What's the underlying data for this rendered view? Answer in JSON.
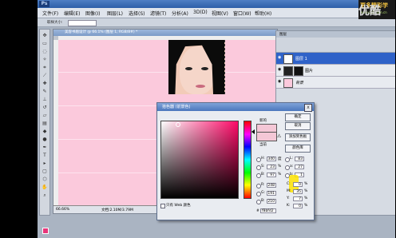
{
  "app": {
    "logo": "Ps",
    "menu": [
      "文件(F)",
      "编辑(E)",
      "图像(I)",
      "图层(L)",
      "选择(S)",
      "滤镜(T)",
      "分析(A)",
      "3D(D)",
      "视图(V)",
      "窗口(W)",
      "帮助(H)"
    ],
    "options_label": "取样大小:"
  },
  "document": {
    "title": "美容书眉设计 @ 66.1% (图层 1, RGB/8#) *",
    "zoom": "66.66%",
    "info": "文档:2.10M/3.79M"
  },
  "layers_panel": {
    "tab": "图层",
    "layers": [
      {
        "name": "图层 1",
        "active": true
      },
      {
        "name": "图片",
        "active": false
      },
      {
        "name": "背景",
        "active": false
      }
    ]
  },
  "watermark": {
    "text": "更多精彩学",
    "sub": "www.ps5.com.cn",
    "youku": "优酷"
  },
  "color_picker": {
    "title": "拾色器 (前景色)",
    "close": "x",
    "new_label": "新的",
    "current_label": "当前",
    "buttons": [
      "确定",
      "取消",
      "添加到色板",
      "颜色库"
    ],
    "hsb": [
      {
        "label": "H:",
        "value": "340",
        "unit": "度"
      },
      {
        "label": "S:",
        "value": "23",
        "unit": "%"
      },
      {
        "label": "B:",
        "value": "97",
        "unit": "%"
      }
    ],
    "rgb": [
      {
        "label": "R:",
        "value": "248"
      },
      {
        "label": "G:",
        "value": "191"
      },
      {
        "label": "B:",
        "value": "210"
      }
    ],
    "lab": [
      {
        "label": "L:",
        "value": "83"
      },
      {
        "label": "a:",
        "value": "27"
      },
      {
        "label": "b:",
        "value": "1"
      }
    ],
    "cmyk": [
      {
        "label": "C:",
        "value": "0",
        "unit": "%"
      },
      {
        "label": "M:",
        "value": "35",
        "unit": "%"
      },
      {
        "label": "Y:",
        "value": "7",
        "unit": "%"
      },
      {
        "label": "K:",
        "value": "0",
        "unit": "%"
      }
    ],
    "hex": "f8bfd2",
    "web_only": "只有 Web 颜色",
    "colors": {
      "new": "#f4c7d6",
      "current": "#f4c7d6",
      "hue": "#ff0a68"
    }
  }
}
